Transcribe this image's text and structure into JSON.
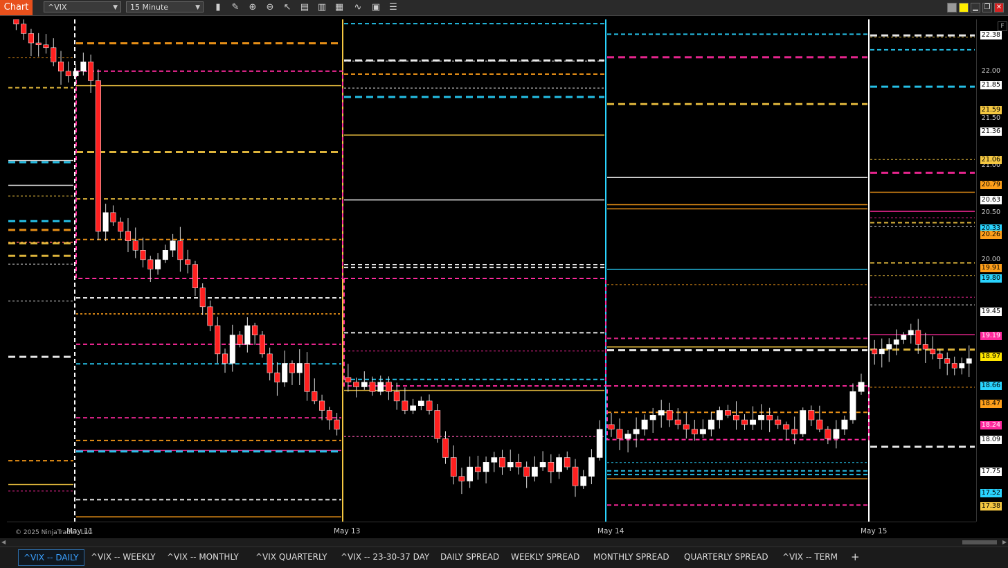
{
  "app": {
    "tab_label": "Chart"
  },
  "toolbar": {
    "instrument": "^VIX",
    "interval": "15 Minute",
    "tools": [
      "bars-icon",
      "pencil-icon",
      "zoom-in-icon",
      "zoom-out-icon",
      "pointer-icon",
      "properties-icon",
      "data-box-icon",
      "strategies-icon",
      "indicators-icon",
      "templates-icon",
      "list-icon"
    ]
  },
  "window_controls": [
    "grey-square-icon",
    "yellow-square-icon",
    "minimize-icon",
    "restore-icon",
    "close-icon"
  ],
  "chart": {
    "copyright": "© 2025 NinjaTrader, LLC",
    "y_scale": {
      "max": 22.55,
      "min": 17.22
    },
    "y_grid_labels": [
      "22.00",
      "21.50",
      "21.00",
      "20.50",
      "20.00"
    ],
    "y_tags": [
      {
        "text": "22.38",
        "bg": "#ffffff",
        "fg": "#000000"
      },
      {
        "text": "21.85",
        "bg": "#ffffff",
        "fg": "#000000"
      },
      {
        "text": "21.59",
        "bg": "#f5c842",
        "fg": "#000000"
      },
      {
        "text": "21.36",
        "bg": "#ffffff",
        "fg": "#000000"
      },
      {
        "text": "21.06",
        "bg": "#f5c842",
        "fg": "#000000"
      },
      {
        "text": "20.79",
        "bg": "#ff9f1a",
        "fg": "#000000"
      },
      {
        "text": "20.63",
        "bg": "#ffffff",
        "fg": "#000000"
      },
      {
        "text": "20.33",
        "bg": "#2ad4ff",
        "fg": "#000000"
      },
      {
        "text": "20.26",
        "bg": "#ff9f1a",
        "fg": "#000000"
      },
      {
        "text": "19.91",
        "bg": "#ff9f1a",
        "fg": "#000000"
      },
      {
        "text": "19.80",
        "bg": "#2ad4ff",
        "fg": "#000000"
      },
      {
        "text": "19.45",
        "bg": "#ffffff",
        "fg": "#000000"
      },
      {
        "text": "19.19",
        "bg": "#ff2a9d",
        "fg": "#ffffff"
      },
      {
        "text": "18.97",
        "bg": "#ffe600",
        "fg": "#000000"
      },
      {
        "text": "18.66",
        "bg": "#2ad4ff",
        "fg": "#000000"
      },
      {
        "text": "18.47",
        "bg": "#ff9f1a",
        "fg": "#000000"
      },
      {
        "text": "18.24",
        "bg": "#ff2a9d",
        "fg": "#ffffff"
      },
      {
        "text": "18.09",
        "bg": "#ffffff",
        "fg": "#000000"
      },
      {
        "text": "17.75",
        "bg": "#ffffff",
        "fg": "#000000"
      },
      {
        "text": "17.52",
        "bg": "#2ad4ff",
        "fg": "#000000"
      },
      {
        "text": "17.38",
        "bg": "#f5c842",
        "fg": "#000000"
      }
    ],
    "x_labels": [
      "May 11",
      "May 13",
      "May 14",
      "May 15"
    ],
    "session_closes": [
      [
        22.5,
        22.4,
        22.3,
        22.28,
        22.25,
        22.1,
        22.0,
        21.95,
        22.0,
        22.1,
        21.9,
        20.3,
        20.5,
        20.4,
        20.3,
        20.2,
        20.1,
        20.0,
        19.9,
        20.0,
        20.1,
        20.2,
        20.0,
        19.95,
        19.7,
        19.5,
        19.3,
        19.0,
        18.9,
        19.2,
        19.1,
        19.3,
        19.2,
        19.0,
        18.8,
        18.7,
        18.9,
        18.8,
        18.9,
        18.6,
        18.5,
        18.4,
        18.3,
        18.2
      ],
      [
        18.7,
        18.65,
        18.7,
        18.6,
        18.7,
        18.6,
        18.5,
        18.4,
        18.45,
        18.5,
        18.4,
        18.1,
        17.9,
        17.7,
        17.65,
        17.8,
        17.75,
        17.85,
        17.9,
        17.8,
        17.85,
        17.8,
        17.7,
        17.8,
        17.85,
        17.75,
        17.9,
        17.8,
        17.6,
        17.7,
        17.9,
        18.2
      ],
      [
        18.2,
        18.1,
        18.15,
        18.2,
        18.3,
        18.35,
        18.4,
        18.3,
        18.25,
        18.2,
        18.15,
        18.2,
        18.3,
        18.4,
        18.35,
        18.3,
        18.25,
        18.3,
        18.35,
        18.3,
        18.25,
        18.2,
        18.15,
        18.4,
        18.3,
        18.2,
        18.1,
        18.2,
        18.3,
        18.6,
        18.7
      ],
      [
        19.0,
        19.05,
        19.1,
        19.15,
        19.2,
        19.25,
        19.1,
        19.05,
        19.0,
        18.95,
        18.9,
        18.85,
        18.9,
        18.95
      ]
    ]
  },
  "tabs": [
    {
      "label": "^VIX -- DAILY",
      "active": true
    },
    {
      "label": "^VIX -- WEEKLY"
    },
    {
      "label": "^VIX -- MONTHLY"
    },
    {
      "label": "^VIX QUARTERLY"
    },
    {
      "label": "^VIX -- 23-30-37 DAY"
    },
    {
      "label": "DAILY SPREAD"
    },
    {
      "label": "WEEKLY SPREAD"
    },
    {
      "label": "MONTHLY SPREAD"
    },
    {
      "label": "QUARTERLY SPREAD"
    },
    {
      "label": "^VIX -- TERM"
    }
  ],
  "add_tab_icon": "plus-icon"
}
